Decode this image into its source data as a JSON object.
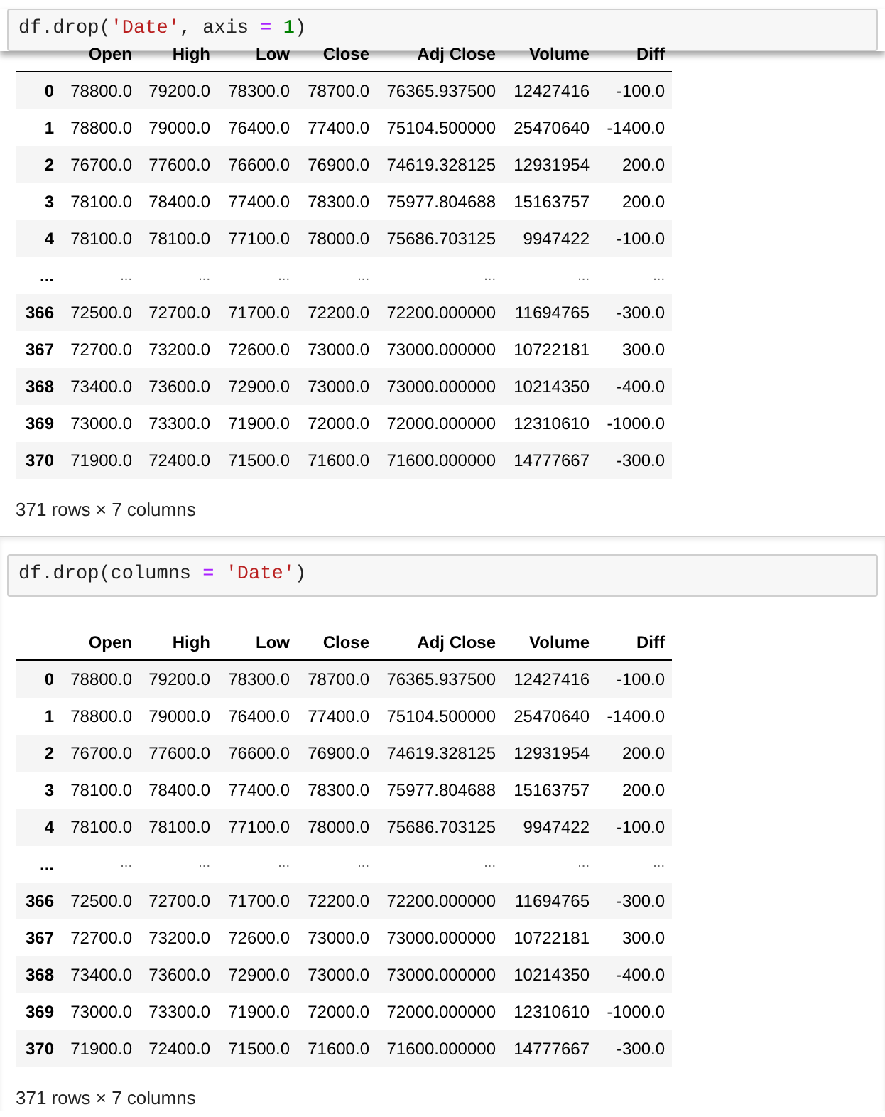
{
  "cells": [
    {
      "code": [
        {
          "kind": "plain",
          "text": "df.drop("
        },
        {
          "kind": "string",
          "text": "'Date'"
        },
        {
          "kind": "plain",
          "text": ", axis "
        },
        {
          "kind": "operator",
          "text": "="
        },
        {
          "kind": "number",
          "text": " 1"
        },
        {
          "kind": "plain",
          "text": ")"
        }
      ],
      "output": {
        "columns": [
          "Open",
          "High",
          "Low",
          "Close",
          "Adj Close",
          "Volume",
          "Diff"
        ],
        "rows": [
          {
            "kind": "data",
            "index": "0",
            "cells": [
              "78800.0",
              "79200.0",
              "78300.0",
              "78700.0",
              "76365.937500",
              "12427416",
              "-100.0"
            ]
          },
          {
            "kind": "data",
            "index": "1",
            "cells": [
              "78800.0",
              "79000.0",
              "76400.0",
              "77400.0",
              "75104.500000",
              "25470640",
              "-1400.0"
            ]
          },
          {
            "kind": "data",
            "index": "2",
            "cells": [
              "76700.0",
              "77600.0",
              "76600.0",
              "76900.0",
              "74619.328125",
              "12931954",
              "200.0"
            ]
          },
          {
            "kind": "data",
            "index": "3",
            "cells": [
              "78100.0",
              "78400.0",
              "77400.0",
              "78300.0",
              "75977.804688",
              "15163757",
              "200.0"
            ]
          },
          {
            "kind": "data",
            "index": "4",
            "cells": [
              "78100.0",
              "78100.0",
              "77100.0",
              "78000.0",
              "75686.703125",
              "9947422",
              "-100.0"
            ]
          },
          {
            "kind": "ellipsis",
            "index": "...",
            "cells": [
              "...",
              "...",
              "...",
              "...",
              "...",
              "...",
              "..."
            ]
          },
          {
            "kind": "data",
            "index": "366",
            "cells": [
              "72500.0",
              "72700.0",
              "71700.0",
              "72200.0",
              "72200.000000",
              "11694765",
              "-300.0"
            ]
          },
          {
            "kind": "data",
            "index": "367",
            "cells": [
              "72700.0",
              "73200.0",
              "72600.0",
              "73000.0",
              "73000.000000",
              "10722181",
              "300.0"
            ]
          },
          {
            "kind": "data",
            "index": "368",
            "cells": [
              "73400.0",
              "73600.0",
              "72900.0",
              "73000.0",
              "73000.000000",
              "10214350",
              "-400.0"
            ]
          },
          {
            "kind": "data",
            "index": "369",
            "cells": [
              "73000.0",
              "73300.0",
              "71900.0",
              "72000.0",
              "72000.000000",
              "12310610",
              "-1000.0"
            ]
          },
          {
            "kind": "data",
            "index": "370",
            "cells": [
              "71900.0",
              "72400.0",
              "71500.0",
              "71600.0",
              "71600.000000",
              "14777667",
              "-300.0"
            ]
          }
        ],
        "summary": "371 rows × 7 columns"
      }
    },
    {
      "code": [
        {
          "kind": "plain",
          "text": "df.drop(columns "
        },
        {
          "kind": "operator",
          "text": "="
        },
        {
          "kind": "string",
          "text": " 'Date'"
        },
        {
          "kind": "plain",
          "text": ")"
        }
      ],
      "output": {
        "columns": [
          "Open",
          "High",
          "Low",
          "Close",
          "Adj Close",
          "Volume",
          "Diff"
        ],
        "rows": [
          {
            "kind": "data",
            "index": "0",
            "cells": [
              "78800.0",
              "79200.0",
              "78300.0",
              "78700.0",
              "76365.937500",
              "12427416",
              "-100.0"
            ]
          },
          {
            "kind": "data",
            "index": "1",
            "cells": [
              "78800.0",
              "79000.0",
              "76400.0",
              "77400.0",
              "75104.500000",
              "25470640",
              "-1400.0"
            ]
          },
          {
            "kind": "data",
            "index": "2",
            "cells": [
              "76700.0",
              "77600.0",
              "76600.0",
              "76900.0",
              "74619.328125",
              "12931954",
              "200.0"
            ]
          },
          {
            "kind": "data",
            "index": "3",
            "cells": [
              "78100.0",
              "78400.0",
              "77400.0",
              "78300.0",
              "75977.804688",
              "15163757",
              "200.0"
            ]
          },
          {
            "kind": "data",
            "index": "4",
            "cells": [
              "78100.0",
              "78100.0",
              "77100.0",
              "78000.0",
              "75686.703125",
              "9947422",
              "-100.0"
            ]
          },
          {
            "kind": "ellipsis",
            "index": "...",
            "cells": [
              "...",
              "...",
              "...",
              "...",
              "...",
              "...",
              "..."
            ]
          },
          {
            "kind": "data",
            "index": "366",
            "cells": [
              "72500.0",
              "72700.0",
              "71700.0",
              "72200.0",
              "72200.000000",
              "11694765",
              "-300.0"
            ]
          },
          {
            "kind": "data",
            "index": "367",
            "cells": [
              "72700.0",
              "73200.0",
              "72600.0",
              "73000.0",
              "73000.000000",
              "10722181",
              "300.0"
            ]
          },
          {
            "kind": "data",
            "index": "368",
            "cells": [
              "73400.0",
              "73600.0",
              "72900.0",
              "73000.0",
              "73000.000000",
              "10214350",
              "-400.0"
            ]
          },
          {
            "kind": "data",
            "index": "369",
            "cells": [
              "73000.0",
              "73300.0",
              "71900.0",
              "72000.0",
              "72000.000000",
              "12310610",
              "-1000.0"
            ]
          },
          {
            "kind": "data",
            "index": "370",
            "cells": [
              "71900.0",
              "72400.0",
              "71500.0",
              "71600.0",
              "71600.000000",
              "14777667",
              "-300.0"
            ]
          }
        ],
        "summary": "371 rows × 7 columns"
      }
    }
  ]
}
